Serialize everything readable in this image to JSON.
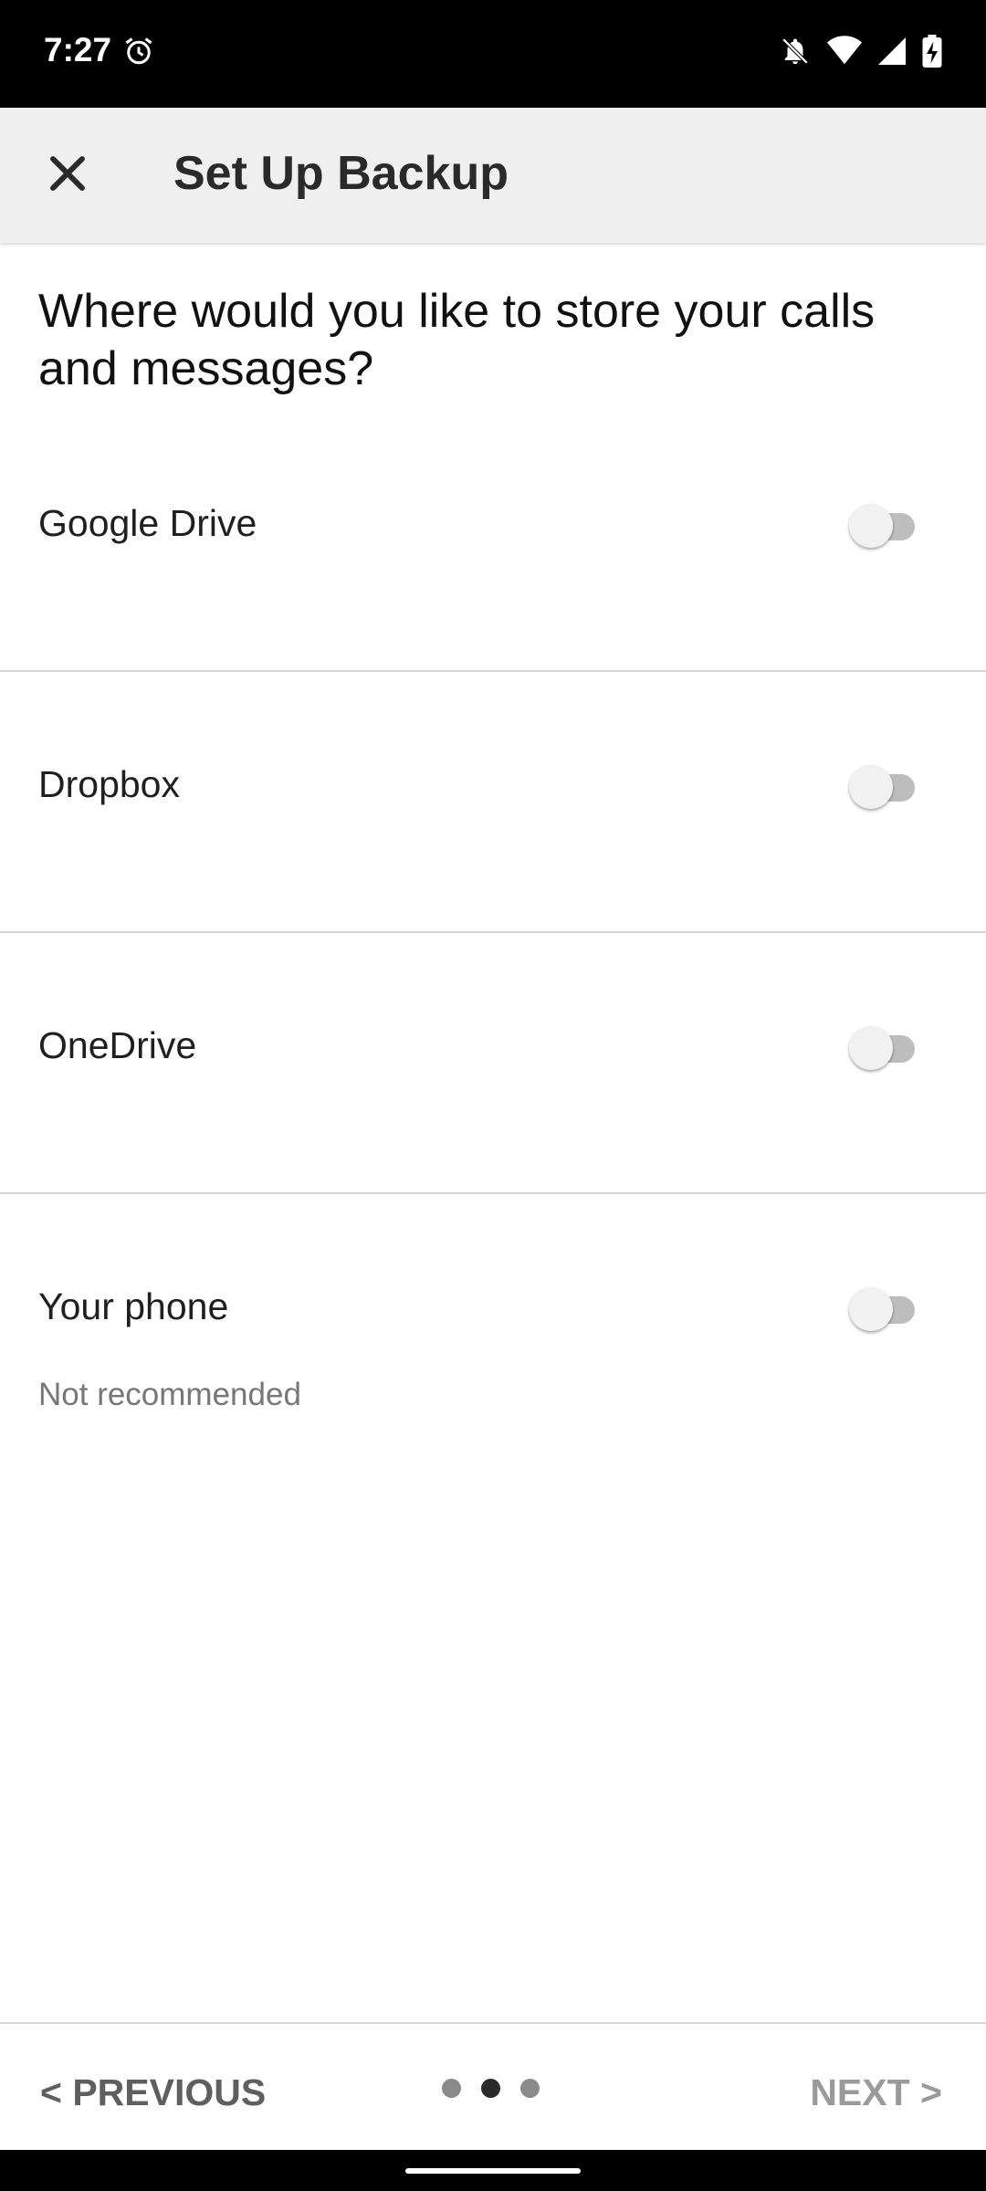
{
  "status_bar": {
    "time": "7:27"
  },
  "app_bar": {
    "title": "Set Up Backup"
  },
  "question": "Where would you like to store your calls and messages?",
  "options": [
    {
      "label": "Google Drive",
      "subtitle": "",
      "enabled": false
    },
    {
      "label": "Dropbox",
      "subtitle": "",
      "enabled": false
    },
    {
      "label": "OneDrive",
      "subtitle": "",
      "enabled": false
    },
    {
      "label": "Your phone",
      "subtitle": "Not recommended",
      "enabled": false
    }
  ],
  "footer": {
    "previous_label": "< PREVIOUS",
    "next_label": "NEXT >",
    "page_count": 3,
    "current_page": 2
  },
  "colors": {
    "app_bar_bg": "#efefef",
    "status_bar_bg": "#000000",
    "toggle_off_track": "#bdbdbd"
  }
}
